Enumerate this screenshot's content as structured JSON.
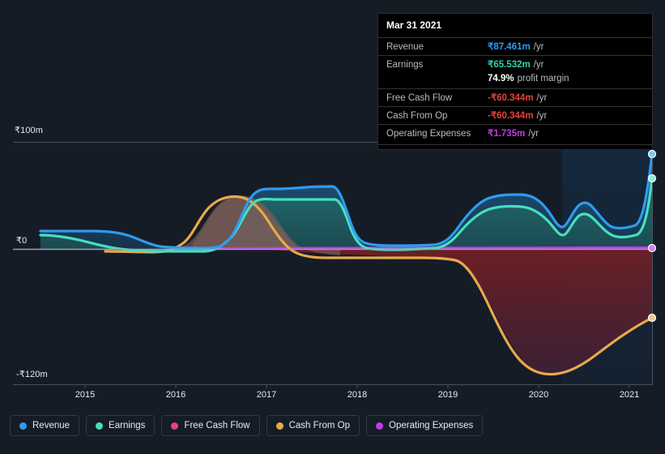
{
  "tooltip": {
    "date": "Mar 31 2021",
    "rows": [
      {
        "key": "Revenue",
        "value": "₹87.461m",
        "suffix": "/yr",
        "color": "#2e9bf0"
      },
      {
        "key": "Earnings",
        "value": "₹65.532m",
        "suffix": "/yr",
        "color": "#2fd2ab"
      },
      {
        "key": "",
        "value": "74.9%",
        "suffix": "profit margin",
        "color": "#ffffff"
      },
      {
        "key": "Free Cash Flow",
        "value": "-₹60.344m",
        "suffix": "/yr",
        "color": "#e8413a"
      },
      {
        "key": "Cash From Op",
        "value": "-₹60.344m",
        "suffix": "/yr",
        "color": "#e8413a"
      },
      {
        "key": "Operating Expenses",
        "value": "₹1.735m",
        "suffix": "/yr",
        "color": "#c13ae8"
      }
    ]
  },
  "legend": {
    "items": [
      {
        "label": "Revenue",
        "color": "#2e9bf0"
      },
      {
        "label": "Earnings",
        "color": "#45dfc0"
      },
      {
        "label": "Free Cash Flow",
        "color": "#e0447e"
      },
      {
        "label": "Cash From Op",
        "color": "#eaa84a"
      },
      {
        "label": "Operating Expenses",
        "color": "#c13ae8"
      }
    ]
  },
  "axes": {
    "y_top_label": "₹100m",
    "y_zero_label": "₹0",
    "y_bottom_label": "-₹120m",
    "x_labels": [
      "2015",
      "2016",
      "2017",
      "2018",
      "2019",
      "2020",
      "2021"
    ]
  },
  "chart_data": {
    "type": "area",
    "title": "",
    "xlabel": "",
    "ylabel": "",
    "currency": "INR",
    "unit": "m",
    "ylim": [
      -120,
      100
    ],
    "y_ticks": [
      100,
      0,
      -120
    ],
    "y_tick_labels": [
      "₹100m",
      "₹0",
      "-₹120m"
    ],
    "x_tick_labels": [
      "2015",
      "2016",
      "2017",
      "2018",
      "2019",
      "2020",
      "2021"
    ],
    "grid": true,
    "legend_position": "bottom",
    "forecast_band": {
      "start": "2020.55",
      "end": "2021.3",
      "label": ""
    },
    "x": [
      2014.55,
      2014.8,
      2015.0,
      2015.25,
      2015.5,
      2015.75,
      2016.0,
      2016.25,
      2016.5,
      2016.75,
      2017.0,
      2017.25,
      2017.5,
      2017.75,
      2018.0,
      2018.25,
      2018.5,
      2018.75,
      2019.0,
      2019.25,
      2019.5,
      2019.75,
      2020.0,
      2020.25,
      2020.5,
      2020.75,
      2021.0,
      2021.25
    ],
    "series": [
      {
        "name": "Revenue",
        "color": "#2e9bf0",
        "fill": "#1b4463",
        "values": [
          9.5,
          9.5,
          9.4,
          8.5,
          5.0,
          4.0,
          3.8,
          3.7,
          4.0,
          22.0,
          48.0,
          51.0,
          53.0,
          54.0,
          53.0,
          21.0,
          10.0,
          8.5,
          9.0,
          26.0,
          43.0,
          47.0,
          47.5,
          33.0,
          42.0,
          32.0,
          33.0,
          87.461
        ]
      },
      {
        "name": "Earnings",
        "color": "#45dfc0",
        "fill": "#1d4e55",
        "values": [
          7.0,
          6.5,
          5.5,
          3.0,
          0.6,
          0.2,
          0.1,
          0.1,
          1.0,
          17.0,
          35.0,
          37.0,
          37.5,
          38.0,
          37.0,
          12.0,
          3.0,
          1.5,
          2.0,
          17.0,
          31.0,
          33.5,
          33.0,
          20.0,
          29.0,
          20.5,
          22.0,
          65.532
        ]
      },
      {
        "name": "Free Cash Flow",
        "color": "#e0447e",
        "values": [
          null,
          null,
          null,
          null,
          null,
          null,
          null,
          null,
          null,
          null,
          null,
          null,
          null,
          null,
          null,
          null,
          null,
          null,
          null,
          null,
          null,
          null,
          null,
          null,
          null,
          null,
          null,
          -60.344
        ]
      },
      {
        "name": "Cash From Op",
        "color": "#eaa84a",
        "fill": "#6b2127",
        "values": [
          null,
          null,
          -2.0,
          -2.5,
          -3.0,
          -3.5,
          -3.5,
          6.0,
          26.0,
          40.0,
          44.0,
          42.0,
          34.0,
          20.0,
          2.0,
          -10.0,
          -13.0,
          -13.5,
          -14.0,
          -40.0,
          -82.0,
          -108.0,
          -114.0,
          -112.0,
          -99.0,
          -85.0,
          -72.0,
          -60.344
        ]
      },
      {
        "name": "Operating Expenses",
        "color": "#c13ae8",
        "values": [
          null,
          null,
          null,
          null,
          null,
          null,
          0.5,
          0.8,
          1.0,
          1.2,
          1.3,
          1.4,
          1.4,
          1.4,
          1.4,
          1.4,
          1.45,
          1.5,
          1.5,
          1.55,
          1.6,
          1.6,
          1.65,
          1.65,
          1.7,
          1.7,
          1.72,
          1.735
        ]
      }
    ],
    "end_markers": [
      {
        "series": "Revenue",
        "value": 87.461,
        "color": "#2e9bf0"
      },
      {
        "series": "Earnings",
        "value": 65.532,
        "color": "#45dfc0"
      },
      {
        "series": "Operating Expenses",
        "value": 1.735,
        "color": "#c13ae8"
      },
      {
        "series": "Cash From Op",
        "value": -60.344,
        "color": "#eaa84a"
      }
    ]
  }
}
